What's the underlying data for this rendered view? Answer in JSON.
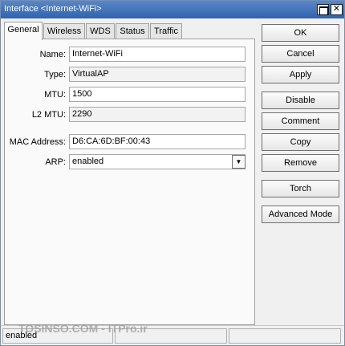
{
  "window": {
    "title": "Interface <Internet-WiFi>",
    "titlebar_color": "#2f63b0"
  },
  "tabs": [
    {
      "label": "General",
      "active": true
    },
    {
      "label": "Wireless",
      "active": false
    },
    {
      "label": "WDS",
      "active": false
    },
    {
      "label": "Status",
      "active": false
    },
    {
      "label": "Traffic",
      "active": false
    }
  ],
  "form": {
    "name_label": "Name:",
    "name_value": "Internet-WiFi",
    "type_label": "Type:",
    "type_value": "VirtualAP",
    "mtu_label": "MTU:",
    "mtu_value": "1500",
    "l2mtu_label": "L2 MTU:",
    "l2mtu_value": "2290",
    "mac_label": "MAC Address:",
    "mac_value": "D6:CA:6D:BF:00:43",
    "arp_label": "ARP:",
    "arp_value": "enabled"
  },
  "buttons": {
    "ok": "OK",
    "cancel": "Cancel",
    "apply": "Apply",
    "disable": "Disable",
    "comment": "Comment",
    "copy": "Copy",
    "remove": "Remove",
    "torch": "Torch",
    "advanced_mode": "Advanced Mode"
  },
  "statusbar": {
    "state": "enabled"
  },
  "watermark": "TOSINSO.COM  -  ITPro.ir"
}
